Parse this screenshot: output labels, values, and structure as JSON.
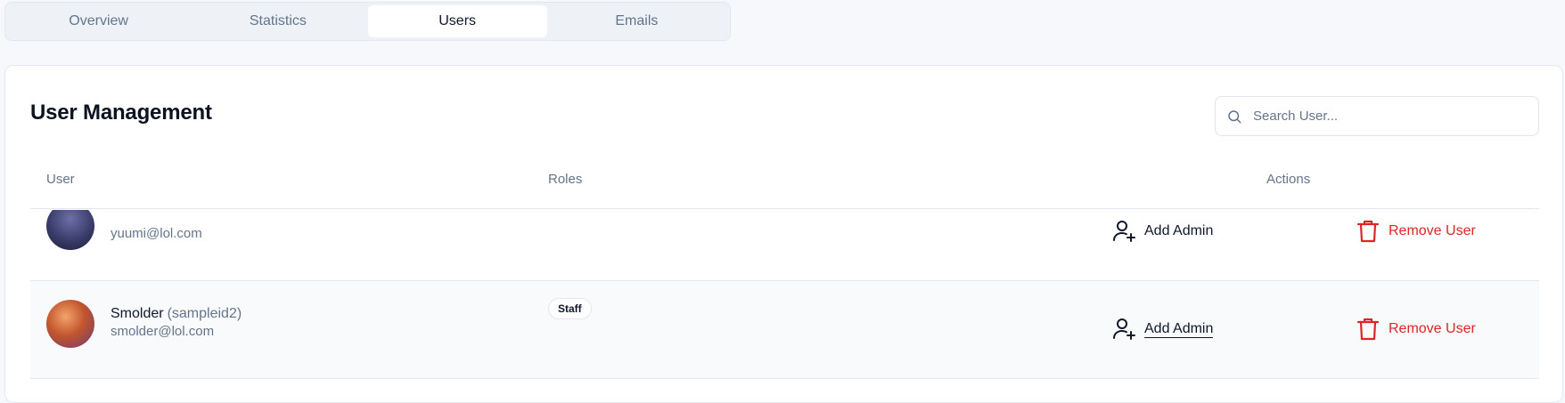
{
  "tabs": [
    {
      "label": "Overview",
      "active": false
    },
    {
      "label": "Statistics",
      "active": false
    },
    {
      "label": "Users",
      "active": true
    },
    {
      "label": "Emails",
      "active": false
    }
  ],
  "card": {
    "title": "User Management",
    "search": {
      "placeholder": "Search User...",
      "value": "",
      "icon": "search-icon"
    }
  },
  "table": {
    "headers": {
      "user": "User",
      "roles": "Roles",
      "actions": "Actions"
    },
    "rows": [
      {
        "name": "",
        "uid": "",
        "email": "yuumi@lol.com",
        "role": "",
        "add_admin_label": "Add Admin",
        "remove_user_label": "Remove User"
      },
      {
        "name": "Smolder",
        "uid": "(sampleid2)",
        "email": "smolder@lol.com",
        "role": "Staff",
        "add_admin_label": "Add Admin",
        "remove_user_label": "Remove User"
      }
    ]
  },
  "colors": {
    "danger": "#dc2626",
    "muted": "#64748b",
    "text": "#0f172a"
  }
}
